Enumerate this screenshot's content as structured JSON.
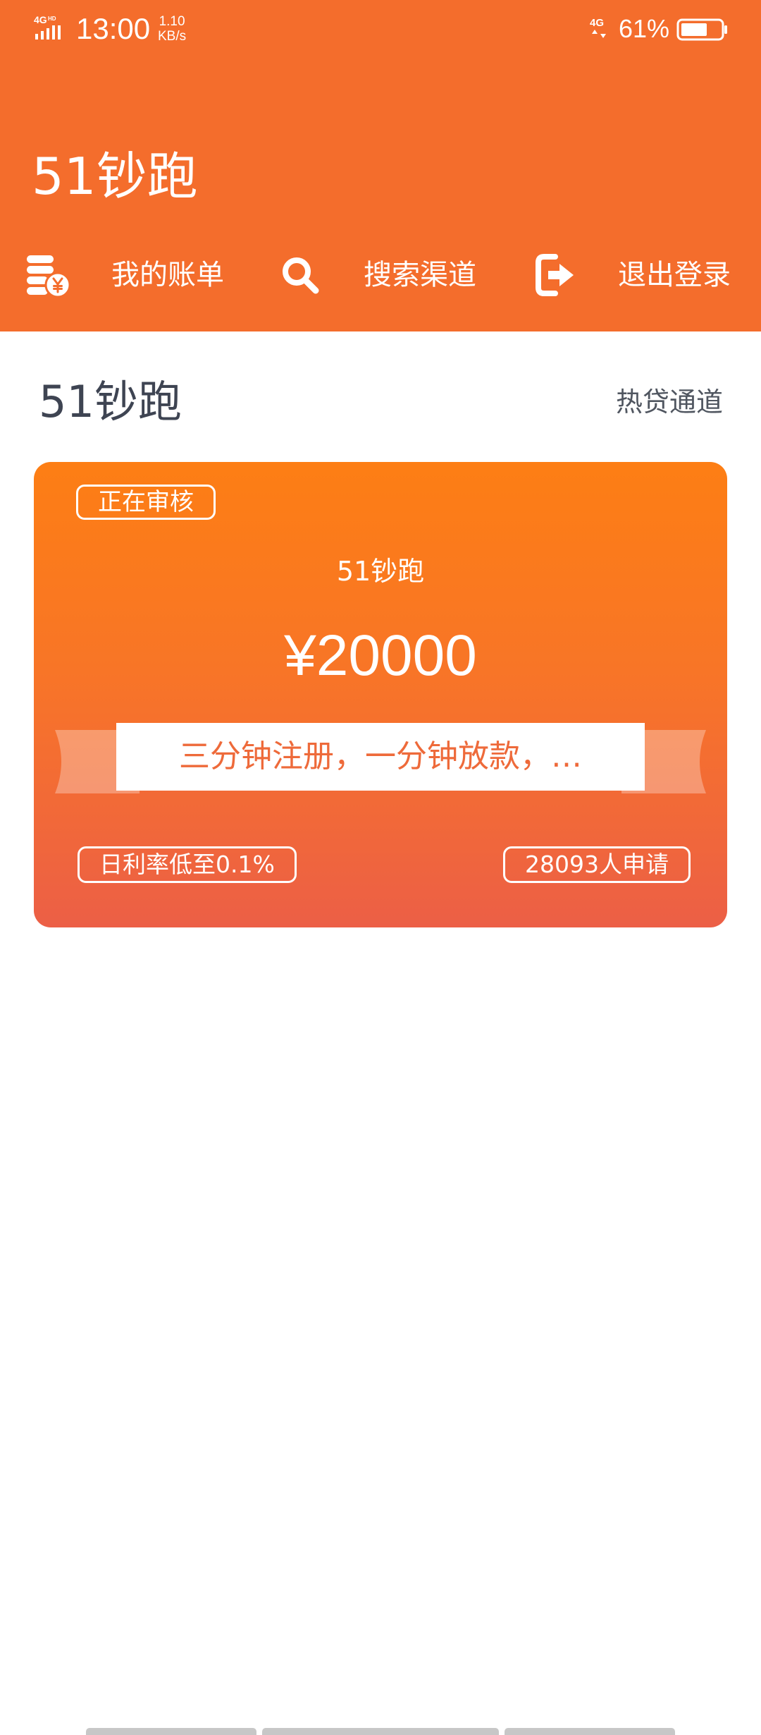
{
  "status_bar": {
    "network": "4G HD",
    "time": "13:00",
    "speed_value": "1.10",
    "speed_unit": "KB/s",
    "network_secondary": "4G",
    "battery": "61%"
  },
  "header": {
    "title": "51钞跑",
    "background_color": "#f46d2c",
    "nav": [
      {
        "label": "我的账单",
        "icon": "bill-coins-icon"
      },
      {
        "label": "搜索渠道",
        "icon": "search-icon"
      },
      {
        "label": "退出登录",
        "icon": "logout-icon"
      }
    ]
  },
  "section": {
    "title": "51钞跑",
    "link": "热贷通道"
  },
  "loan_card": {
    "status": "正在审核",
    "name": "51钞跑",
    "amount": "¥20000",
    "slogan": "三分钟注册，一分钟放款，…",
    "rate": "日利率低至0.1%",
    "applicants": "28093人申请",
    "gradient_colors": [
      "#fd7e14",
      "#ec5f46"
    ],
    "slogan_color": "#ee6a3a"
  }
}
